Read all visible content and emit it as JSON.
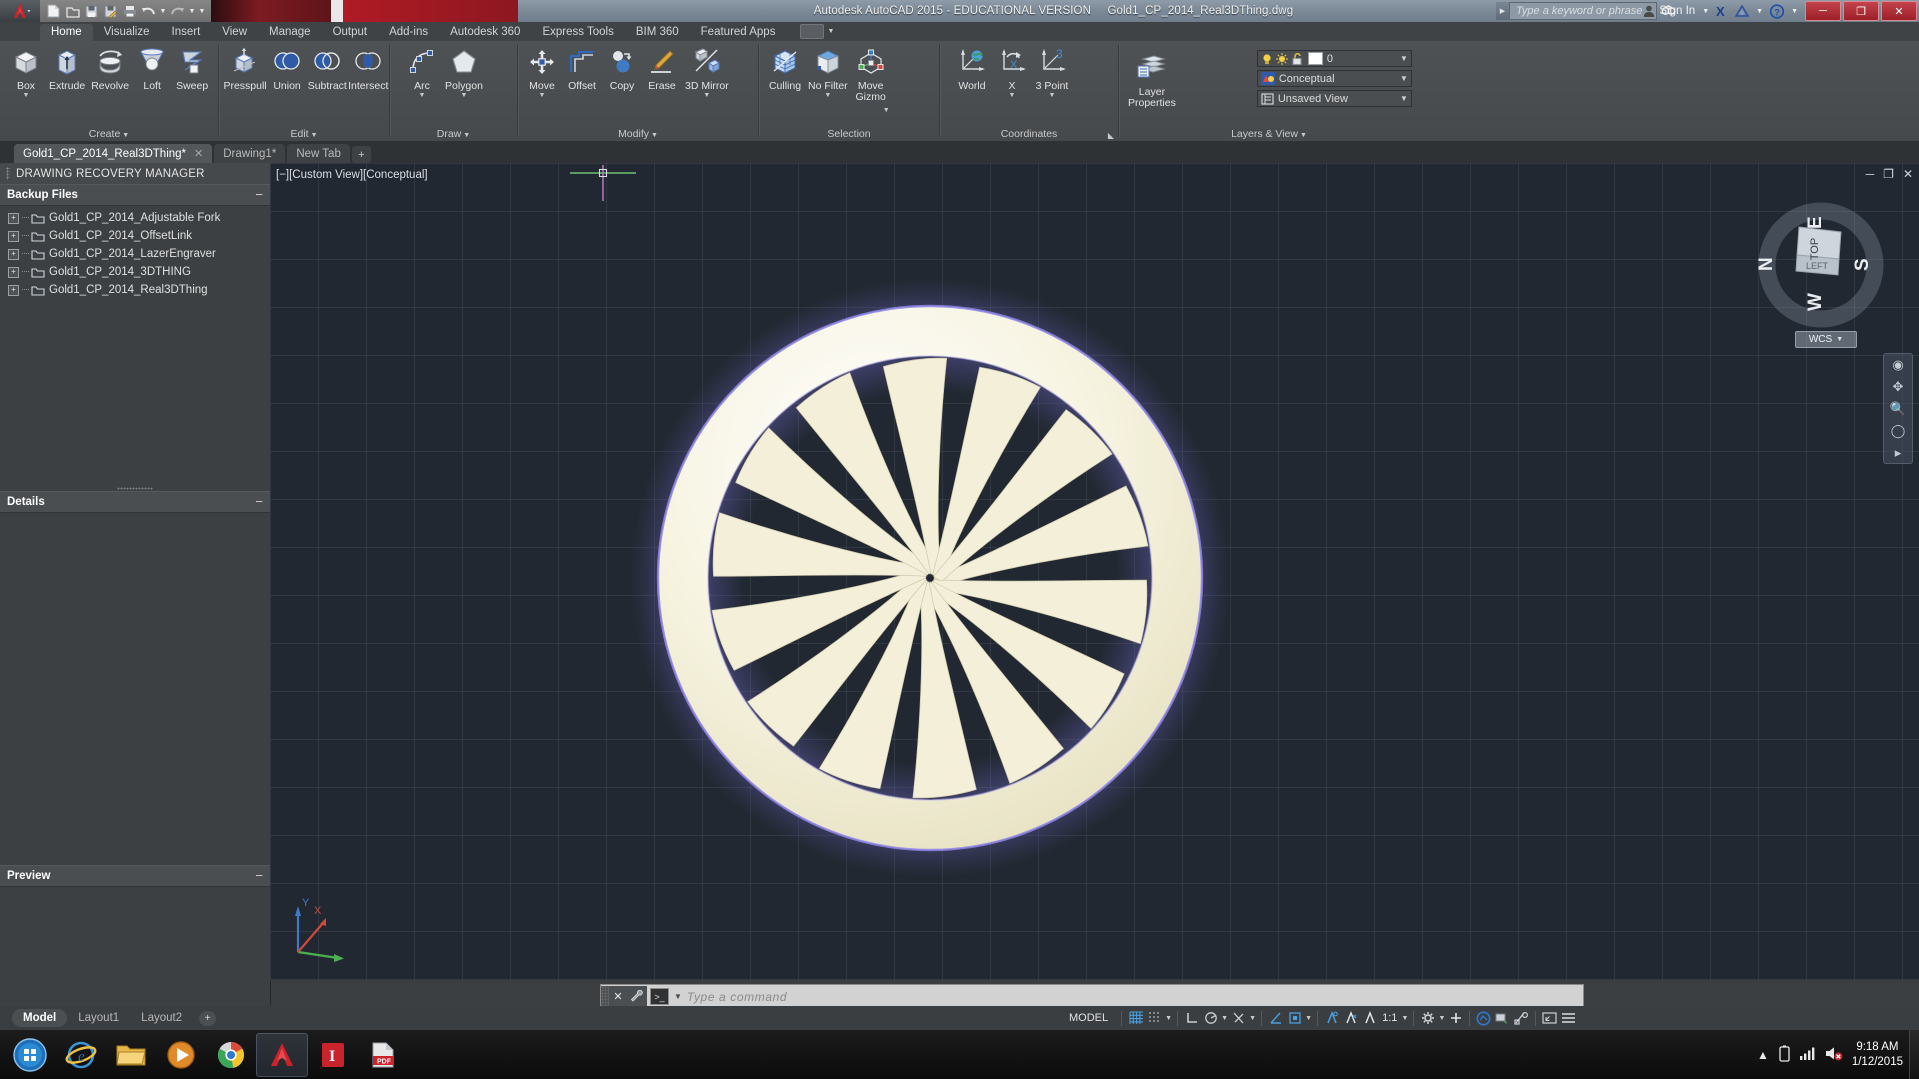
{
  "titlebar": {
    "app_title": "Autodesk AutoCAD 2015 - EDUCATIONAL VERSION",
    "document": "Gold1_CP_2014_Real3DThing.dwg",
    "search_placeholder": "Type a keyword or phrase",
    "sign_in": "Sign In",
    "minimize": "─",
    "restore": "❐",
    "close": "✕"
  },
  "ribbon_tabs": [
    {
      "label": "Home",
      "active": true
    },
    {
      "label": "Visualize",
      "active": false
    },
    {
      "label": "Insert",
      "active": false
    },
    {
      "label": "View",
      "active": false
    },
    {
      "label": "Manage",
      "active": false
    },
    {
      "label": "Output",
      "active": false
    },
    {
      "label": "Add-ins",
      "active": false
    },
    {
      "label": "Autodesk 360",
      "active": false
    },
    {
      "label": "Express Tools",
      "active": false
    },
    {
      "label": "BIM 360",
      "active": false
    },
    {
      "label": "Featured Apps",
      "active": false
    }
  ],
  "panels": {
    "create": {
      "label": "Create",
      "buttons": [
        {
          "name": "box",
          "label": "Box",
          "dropdown": true
        },
        {
          "name": "extrude",
          "label": "Extrude",
          "dropdown": false
        },
        {
          "name": "revolve",
          "label": "Revolve",
          "dropdown": false
        },
        {
          "name": "loft",
          "label": "Loft",
          "dropdown": false
        },
        {
          "name": "sweep",
          "label": "Sweep",
          "dropdown": false
        }
      ]
    },
    "edit": {
      "label": "Edit",
      "buttons": [
        {
          "name": "presspull",
          "label": "Presspull",
          "dropdown": false
        },
        {
          "name": "union",
          "label": "Union",
          "dropdown": false
        },
        {
          "name": "subtract",
          "label": "Subtract",
          "dropdown": false
        },
        {
          "name": "intersect",
          "label": "Intersect",
          "dropdown": false
        }
      ]
    },
    "draw": {
      "label": "Draw",
      "buttons": [
        {
          "name": "arc",
          "label": "Arc",
          "dropdown": true
        },
        {
          "name": "polygon",
          "label": "Polygon",
          "dropdown": true
        }
      ]
    },
    "modify": {
      "label": "Modify",
      "buttons": [
        {
          "name": "move",
          "label": "Move",
          "dropdown": true
        },
        {
          "name": "offset",
          "label": "Offset",
          "dropdown": false
        },
        {
          "name": "copy",
          "label": "Copy",
          "dropdown": false
        },
        {
          "name": "erase",
          "label": "Erase",
          "dropdown": false
        },
        {
          "name": "3d-mirror",
          "label": "3D Mirror",
          "dropdown": true
        }
      ]
    },
    "selection": {
      "label": "Selection",
      "buttons": [
        {
          "name": "culling",
          "label": "Culling",
          "dropdown": false
        },
        {
          "name": "no-filter",
          "label": "No Filter",
          "dropdown": true
        },
        {
          "name": "move-gizmo",
          "label": "Move",
          "label2": "Gizmo",
          "dropdown": true
        }
      ]
    },
    "coordinates": {
      "label": "Coordinates",
      "buttons": [
        {
          "name": "world",
          "label": "World",
          "dropdown": false
        },
        {
          "name": "ucs-x",
          "label": "X",
          "dropdown": true
        },
        {
          "name": "3-point",
          "label": "3 Point",
          "dropdown": true
        }
      ]
    },
    "layers_view": {
      "label": "Layers & View",
      "layer_properties_label": "Layer",
      "layer_properties_label2": "Properties",
      "layer_value": "0",
      "visual_style": "Conceptual",
      "view_name": "Unsaved View"
    }
  },
  "file_tabs": [
    {
      "label": "Gold1_CP_2014_Real3DThing*",
      "active": true,
      "closable": true
    },
    {
      "label": "Drawing1*",
      "active": false,
      "closable": false
    },
    {
      "label": "New Tab",
      "active": false,
      "closable": false
    }
  ],
  "file_tab_add": "+",
  "palette": {
    "title": "DRAWING RECOVERY MANAGER",
    "sections": [
      {
        "name": "backup-files",
        "title": "Backup Files",
        "collapse": "−",
        "items": [
          "Gold1_CP_2014_Adjustable Fork",
          "Gold1_CP_2014_OffsetLink",
          "Gold1_CP_2014_LazerEngraver",
          "Gold1_CP_2014_3DTHING",
          "Gold1_CP_2014_Real3DThing"
        ]
      },
      {
        "name": "details",
        "title": "Details",
        "collapse": "−",
        "items": []
      },
      {
        "name": "preview",
        "title": "Preview",
        "collapse": "−",
        "items": []
      }
    ]
  },
  "viewport": {
    "label": "[−][Custom View][Conceptual]",
    "minimize": "─",
    "restore": "❐",
    "close": "✕",
    "viewcube": {
      "top": "TOP",
      "left": "LEFT",
      "n": "N",
      "e": "E",
      "s": "S",
      "w": "W"
    },
    "wcs_label": "WCS",
    "wcs_caret": "▼",
    "ucs_x": "X",
    "ucs_y": "Y"
  },
  "command_line": {
    "placeholder": "Type a command",
    "close": "✕",
    "prompt": ">_",
    "caret": "▼"
  },
  "layout_tabs": [
    {
      "label": "Model",
      "active": true
    },
    {
      "label": "Layout1",
      "active": false
    },
    {
      "label": "Layout2",
      "active": false
    }
  ],
  "layout_add": "+",
  "status_bar": {
    "model_label": "MODEL",
    "scale": "1:1",
    "items": [
      "grid-display-icon",
      "snap-mode-icon",
      "ortho-mode-icon",
      "polar-tracking-icon",
      "isometric-drafting-icon",
      "object-snap-icon",
      "3d-object-snap-icon",
      "annotation-visibility-icon",
      "autoscale-icon",
      "workspace-switching-icon",
      "customization-icon"
    ]
  },
  "taskbar": {
    "clock_time": "9:18 AM",
    "clock_date": "1/12/2015",
    "apps": [
      "internet-explorer-icon",
      "file-explorer-icon",
      "media-player-icon",
      "google-chrome-icon",
      "autocad-icon",
      "inventor-icon",
      "pdf-reader-icon"
    ]
  }
}
